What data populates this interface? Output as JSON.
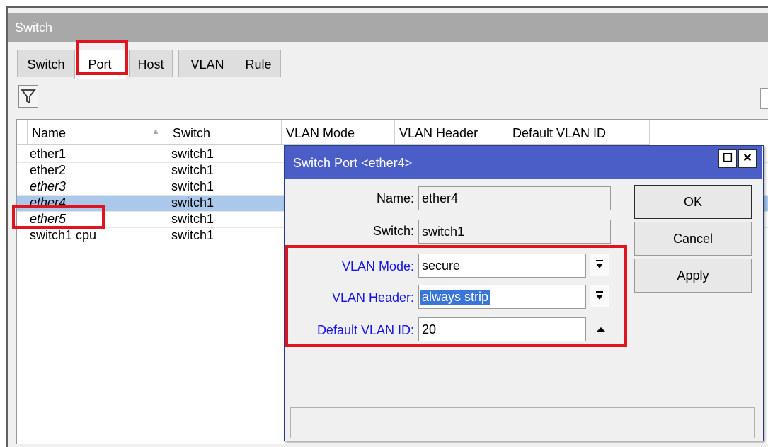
{
  "window": {
    "title": "Switch"
  },
  "tabs": [
    {
      "label": "Switch"
    },
    {
      "label": "Port"
    },
    {
      "label": "Host"
    },
    {
      "label": "VLAN"
    },
    {
      "label": "Rule"
    }
  ],
  "toolbar": {
    "filter_icon": "filter-icon"
  },
  "table": {
    "headers": [
      "Name",
      "Switch",
      "VLAN Mode",
      "VLAN Header",
      "Default VLAN ID"
    ],
    "rows": [
      {
        "name": "ether1",
        "switch": "switch1"
      },
      {
        "name": "ether2",
        "switch": "switch1"
      },
      {
        "name": "ether3",
        "switch": "switch1"
      },
      {
        "name": "ether4",
        "switch": "switch1"
      },
      {
        "name": "ether5",
        "switch": "switch1"
      },
      {
        "name": "switch1 cpu",
        "switch": "switch1"
      }
    ]
  },
  "dialog": {
    "title": "Switch Port <ether4>",
    "fields": {
      "name_label": "Name:",
      "name_value": "ether4",
      "switch_label": "Switch:",
      "switch_value": "switch1",
      "vlan_mode_label": "VLAN Mode:",
      "vlan_mode_value": "secure",
      "vlan_header_label": "VLAN Header:",
      "vlan_header_value": "always strip",
      "default_vlan_label": "Default VLAN ID:",
      "default_vlan_value": "20"
    },
    "buttons": {
      "ok": "OK",
      "cancel": "Cancel",
      "apply": "Apply"
    }
  },
  "colors": {
    "highlight": "#e0141e",
    "dialog_title": "#4b5ec8",
    "selected_row": "#a9c8ea",
    "label_blue": "#1414e6"
  }
}
